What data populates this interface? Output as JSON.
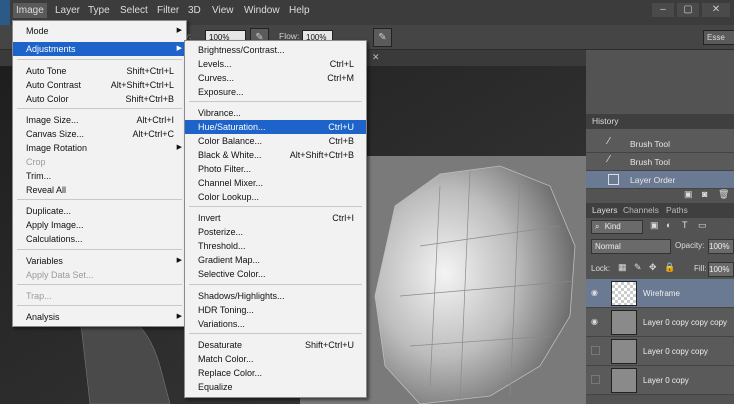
{
  "menubar": {
    "items": [
      "Image",
      "Layer",
      "Type",
      "Select",
      "Filter",
      "3D",
      "View",
      "Window",
      "Help"
    ]
  },
  "options": {
    "opacity_label": "city:",
    "opacity_value": "100%",
    "flow_label": "Flow:",
    "flow_value": "100%",
    "workspace": "Esse"
  },
  "image_menu": {
    "items": [
      {
        "label": "Mode",
        "shortcut": "",
        "sub": true
      },
      {
        "label": "Adjustments",
        "shortcut": "",
        "sub": true,
        "highlighted": true
      },
      {
        "label": "Auto Tone",
        "shortcut": "Shift+Ctrl+L"
      },
      {
        "label": "Auto Contrast",
        "shortcut": "Alt+Shift+Ctrl+L"
      },
      {
        "label": "Auto Color",
        "shortcut": "Shift+Ctrl+B"
      },
      {
        "label": "Image Size...",
        "shortcut": "Alt+Ctrl+I"
      },
      {
        "label": "Canvas Size...",
        "shortcut": "Alt+Ctrl+C"
      },
      {
        "label": "Image Rotation",
        "shortcut": "",
        "sub": true
      },
      {
        "label": "Crop",
        "shortcut": "",
        "disabled": true
      },
      {
        "label": "Trim...",
        "shortcut": ""
      },
      {
        "label": "Reveal All",
        "shortcut": ""
      },
      {
        "label": "Duplicate...",
        "shortcut": ""
      },
      {
        "label": "Apply Image...",
        "shortcut": ""
      },
      {
        "label": "Calculations...",
        "shortcut": ""
      },
      {
        "label": "Variables",
        "shortcut": "",
        "sub": true
      },
      {
        "label": "Apply Data Set...",
        "shortcut": "",
        "disabled": true
      },
      {
        "label": "Trap...",
        "shortcut": "",
        "disabled": true
      },
      {
        "label": "Analysis",
        "shortcut": "",
        "sub": true
      }
    ]
  },
  "adjust_menu": {
    "items": [
      {
        "label": "Brightness/Contrast...",
        "shortcut": ""
      },
      {
        "label": "Levels...",
        "shortcut": "Ctrl+L"
      },
      {
        "label": "Curves...",
        "shortcut": "Ctrl+M"
      },
      {
        "label": "Exposure...",
        "shortcut": ""
      },
      {
        "label": "Vibrance...",
        "shortcut": ""
      },
      {
        "label": "Hue/Saturation...",
        "shortcut": "Ctrl+U",
        "highlighted": true
      },
      {
        "label": "Color Balance...",
        "shortcut": "Ctrl+B"
      },
      {
        "label": "Black & White...",
        "shortcut": "Alt+Shift+Ctrl+B"
      },
      {
        "label": "Photo Filter...",
        "shortcut": ""
      },
      {
        "label": "Channel Mixer...",
        "shortcut": ""
      },
      {
        "label": "Color Lookup...",
        "shortcut": ""
      },
      {
        "label": "Invert",
        "shortcut": "Ctrl+I"
      },
      {
        "label": "Posterize...",
        "shortcut": ""
      },
      {
        "label": "Threshold...",
        "shortcut": ""
      },
      {
        "label": "Gradient Map...",
        "shortcut": ""
      },
      {
        "label": "Selective Color...",
        "shortcut": ""
      },
      {
        "label": "Shadows/Highlights...",
        "shortcut": ""
      },
      {
        "label": "HDR Toning...",
        "shortcut": ""
      },
      {
        "label": "Variations...",
        "shortcut": ""
      },
      {
        "label": "Desaturate",
        "shortcut": "Shift+Ctrl+U"
      },
      {
        "label": "Match Color...",
        "shortcut": ""
      },
      {
        "label": "Replace Color...",
        "shortcut": ""
      },
      {
        "label": "Equalize",
        "shortcut": ""
      }
    ]
  },
  "history": {
    "title": "History",
    "items": [
      "Brush Tool",
      "Brush Tool",
      "Layer Order"
    ]
  },
  "layers": {
    "tabs": [
      "Layers",
      "Channels",
      "Paths"
    ],
    "kind": "Kind",
    "blend": "Normal",
    "opacity_label": "Opacity:",
    "opacity_value": "100%",
    "lock_label": "Lock:",
    "fill_label": "Fill:",
    "fill_value": "100%",
    "items": [
      "Wireframe",
      "Layer 0 copy copy copy",
      "Layer 0 copy copy",
      "Layer 0 copy"
    ]
  }
}
